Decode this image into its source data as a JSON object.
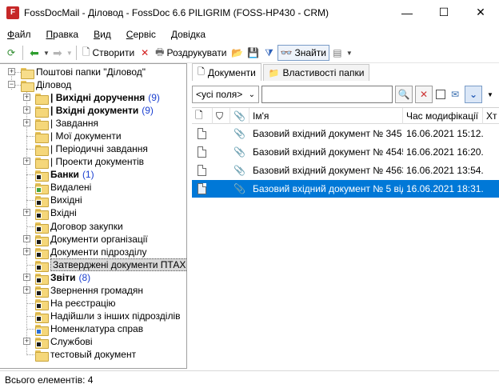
{
  "window": {
    "title": "FossDocMail - Діловод - FossDoc 6.6 PILIGRIM (FOSS-HP430 - CRM)",
    "app_icon_letter": "F",
    "minimize": "—",
    "maximize": "☐",
    "close": "✕"
  },
  "menu": [
    {
      "u": "Ф",
      "rest": "айл"
    },
    {
      "u": "П",
      "rest": "равка"
    },
    {
      "u": "В",
      "rest": "ид"
    },
    {
      "u": "С",
      "rest": "ервіс"
    },
    {
      "u": "Д",
      "rest": "овідка"
    }
  ],
  "toolbar": {
    "create_label": "Створити",
    "print_label": "Роздрукувати",
    "find_label": "Знайти"
  },
  "tree": {
    "mail_folders": "Поштові папки \"Діловод\"",
    "root": "Діловод",
    "items": [
      {
        "label": "| Вихідні доручення",
        "count": "(9)",
        "bold": true,
        "exp": true,
        "badge": ""
      },
      {
        "label": "| Вхідні документи",
        "count": "(9)",
        "bold": true,
        "exp": true,
        "badge": ""
      },
      {
        "label": "| Завдання",
        "count": "",
        "bold": false,
        "exp": true,
        "badge": ""
      },
      {
        "label": "| Мої документи",
        "count": "",
        "bold": false,
        "exp": false,
        "badge": ""
      },
      {
        "label": "| Періодичні завдання",
        "count": "",
        "bold": false,
        "exp": false,
        "badge": ""
      },
      {
        "label": "| Проекти документів",
        "count": "",
        "bold": false,
        "exp": true,
        "badge": ""
      },
      {
        "label": "Банки",
        "count": "(1)",
        "bold": true,
        "exp": false,
        "badge": "black"
      },
      {
        "label": "Видалені",
        "count": "",
        "bold": false,
        "exp": false,
        "badge": "green"
      },
      {
        "label": "Вихідні",
        "count": "",
        "bold": false,
        "exp": false,
        "badge": "black"
      },
      {
        "label": "Вхідні",
        "count": "",
        "bold": false,
        "exp": true,
        "badge": "black"
      },
      {
        "label": "Договор закупки",
        "count": "",
        "bold": false,
        "exp": false,
        "badge": "black"
      },
      {
        "label": "Документи організації",
        "count": "",
        "bold": false,
        "exp": true,
        "badge": "black"
      },
      {
        "label": "Документи підрозділу",
        "count": "",
        "bold": false,
        "exp": true,
        "badge": "black"
      },
      {
        "label": "Затверджені документи ПТАХ",
        "count": "",
        "bold": false,
        "exp": false,
        "badge": "black",
        "selected": true
      },
      {
        "label": "Звіти",
        "count": "(8)",
        "bold": true,
        "exp": true,
        "badge": "black"
      },
      {
        "label": "Звернення громадян",
        "count": "",
        "bold": false,
        "exp": true,
        "badge": "black"
      },
      {
        "label": "На реєстрацію",
        "count": "",
        "bold": false,
        "exp": false,
        "badge": "black"
      },
      {
        "label": "Надійшли з інших підрозділів",
        "count": "",
        "bold": false,
        "exp": false,
        "badge": "black"
      },
      {
        "label": "Номенклатура справ",
        "count": "",
        "bold": false,
        "exp": false,
        "badge": "blue"
      },
      {
        "label": "Службові",
        "count": "",
        "bold": false,
        "exp": true,
        "badge": "black"
      },
      {
        "label": "тестовый документ",
        "count": "",
        "bold": false,
        "exp": false,
        "badge": ""
      }
    ]
  },
  "tabs": [
    {
      "label": "Документи",
      "active": true
    },
    {
      "label": "Властивості папки",
      "active": false
    }
  ],
  "filter": {
    "field_select": "<усі поля>",
    "search_value": ""
  },
  "grid": {
    "columns": [
      "",
      "",
      "",
      "Ім'я",
      "Час модифікації",
      "Хт"
    ],
    "rows": [
      {
        "name": "Базовий вхідний документ № 345 ...",
        "modified": "16.06.2021 15:12...",
        "selected": false
      },
      {
        "name": "Базовий вхідний документ № 4545...",
        "modified": "16.06.2021 16:20...",
        "selected": false
      },
      {
        "name": "Базовий вхідний документ № 4563...",
        "modified": "16.06.2021 13:54...",
        "selected": false
      },
      {
        "name": "Базовий вхідний документ № 5 від...",
        "modified": "16.06.2021 18:31...",
        "selected": true
      }
    ]
  },
  "status": {
    "text": "Всього елементів: 4"
  },
  "colors": {
    "selection": "#0078d7",
    "count": "#1a3fd0"
  }
}
